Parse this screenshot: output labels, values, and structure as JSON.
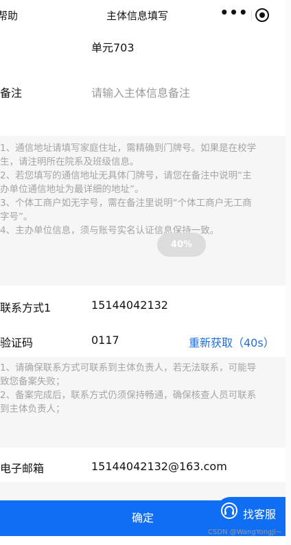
{
  "header": {
    "help": "帮助",
    "title": "主体信息填写",
    "more_glyph": "•••",
    "more_icon": "more-dots-icon",
    "close_icon": "target-close-icon"
  },
  "address": {
    "value": "单元703"
  },
  "remark": {
    "label": "备注",
    "placeholder": "请输入主体信息备注"
  },
  "address_tips": {
    "line1": "1、通信地址请填写家庭住址，需精确到门牌号。如果是在校学",
    "line2": "生，请注明所在院系及班级信息。",
    "line3": "2、若您填写的通信地址无具体门牌号，请您在备注中说明“主",
    "line4": "办单位通信地址为最详细的地址”。",
    "line5": "3、个体工商户如无字号，需在备注里说明“个体工商户无工商",
    "line6": "字号”。",
    "line7": "4、主办单位信息，须与账号实名认证信息保持一致。"
  },
  "progress": {
    "label": "40%",
    "percent": 40
  },
  "contact": {
    "label": "联系方式1",
    "value": "15144042132"
  },
  "code": {
    "label": "验证码",
    "value": "0117",
    "refetch": "重新获取（40s）"
  },
  "contact_tips": {
    "line1": "1、请确保联系方式可联系到主体负责人，若无法联系，可能导",
    "line2": "致您备案失败；",
    "line3": "2、备案完成后，联系方式仍须保持畅通，确保核查人员可联系",
    "line4": "到主体负责人；"
  },
  "email": {
    "label": "电子邮箱",
    "value": "15144042132@163.com"
  },
  "footer": {
    "confirm": "确定",
    "service": "找客服",
    "service_icon": "headset-icon"
  },
  "watermark": "CSDN @WangYongJi~",
  "colors": {
    "accent": "#0f6ef4",
    "link": "#1a6fe0",
    "tip_bg": "#f6f6f6",
    "tip_text": "#a4a4a4"
  }
}
